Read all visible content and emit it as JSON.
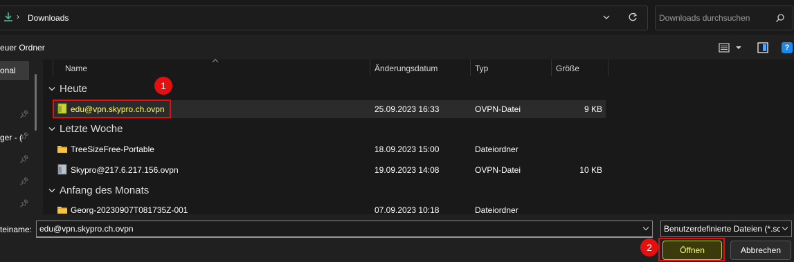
{
  "address": {
    "path": "Downloads"
  },
  "search": {
    "placeholder": "Downloads durchsuchen"
  },
  "toolbar": {
    "new_folder": "euer Ordner"
  },
  "nav": {
    "items": [
      {
        "label": "onal"
      },
      {
        "label": "ger - ("
      }
    ]
  },
  "columns": {
    "name": "Name",
    "date": "Änderungsdatum",
    "type": "Typ",
    "size": "Größe"
  },
  "groups": [
    {
      "label": "Heute",
      "rows": [
        {
          "name": "edu@vpn.skypro.ch.ovpn",
          "date": "25.09.2023 16:33",
          "type": "OVPN-Datei",
          "size": "9 KB",
          "icon": "ovpn-file-icon",
          "selected": true
        }
      ]
    },
    {
      "label": "Letzte Woche",
      "rows": [
        {
          "name": "TreeSizeFree-Portable",
          "date": "18.09.2023 15:00",
          "type": "Dateiordner",
          "size": "",
          "icon": "folder-icon"
        },
        {
          "name": "Skypro@217.6.217.156.ovpn",
          "date": "19.09.2023 14:08",
          "type": "OVPN-Datei",
          "size": "10 KB",
          "icon": "ovpn-file-icon"
        }
      ]
    },
    {
      "label": "Anfang des Monats",
      "rows": [
        {
          "name": "Georg-20230907T081735Z-001",
          "date": "07.09.2023 10:18",
          "type": "Dateiordner",
          "size": "",
          "icon": "folder-icon"
        }
      ]
    }
  ],
  "bottom": {
    "filename_label": "teiname:",
    "filename_value": "edu@vpn.skypro.ch.ovpn",
    "filetype_value": "Benutzerdefinierte Dateien (*.sc",
    "open_label": "Öffnen",
    "cancel_label": "Abbrechen"
  },
  "callouts": [
    "1",
    "2"
  ],
  "colors": {
    "callout_red": "#e41010",
    "selection_yellow": "#ffff66",
    "download_green": "#3fbf8f"
  }
}
